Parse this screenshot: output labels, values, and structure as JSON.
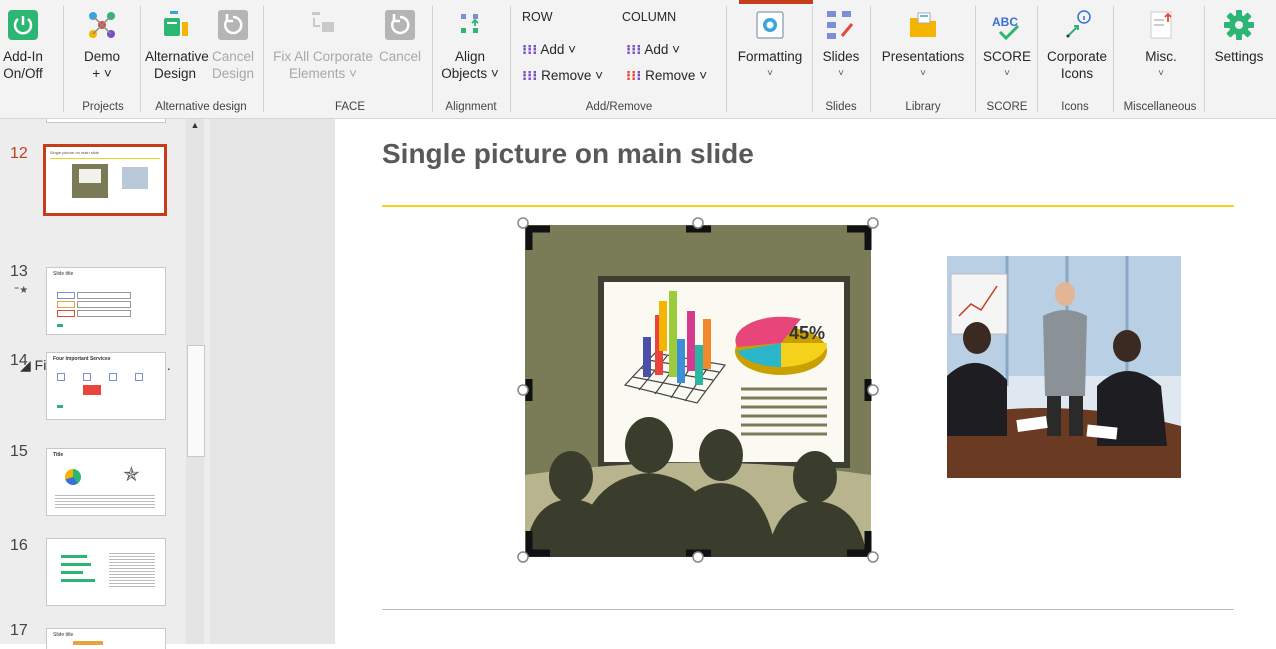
{
  "ribbon": {
    "addin_label_1": "Add-In",
    "addin_label_2": "On/Off",
    "demo_label_1": "Demo",
    "demo_label_2": "+ ˅",
    "projects_group": "Projects",
    "alt_design_1": "Alternative",
    "alt_design_2": "Design",
    "cancel_design_1": "Cancel",
    "cancel_design_2": "Design",
    "alt_group": "Alternative design",
    "fix_all_1": "Fix All Corporate",
    "fix_all_2": "Elements ˅",
    "cancel_face": "Cancel",
    "face_group": "FACE",
    "align_1": "Align",
    "align_2": "Objects ˅",
    "alignment_group": "Alignment",
    "row_header": "ROW",
    "column_header": "COLUMN",
    "row_add": "Add ˅",
    "row_remove": "Remove ˅",
    "col_add": "Add ˅",
    "col_remove": "Remove ˅",
    "add_remove_group": "Add/Remove",
    "formatting": "Formatting",
    "slides_btn": "Slides",
    "slides_group": "Slides",
    "presentations_btn": "Presentations",
    "library_group": "Library",
    "score_btn": "SCORE",
    "score_group": "SCORE",
    "corp_icons_1": "Corporate",
    "corp_icons_2": "Icons",
    "icons_group": "Icons",
    "misc_btn": "Misc.",
    "misc_group": "Miscellaneous",
    "settings_btn": "Settings",
    "abc_icon_text": "ABC"
  },
  "thumbnails": {
    "n12": "12",
    "n13": "13",
    "n14": "14",
    "n15": "15",
    "n16": "16",
    "n17": "17",
    "section": "◢ Fix Colors, Fonts, Ti...",
    "t12_title": "Single picture on main slide",
    "t13_title": "Slide title",
    "t14_title": "Four Important Services",
    "t15_title": "Title",
    "t17_title": "Slide title"
  },
  "slide": {
    "title": "Single picture on main slide",
    "pie_label": "45%"
  },
  "colors": {
    "accent": "#c43e1c",
    "title_rule": "#f4d21c",
    "addin_green": "#2bb673"
  }
}
